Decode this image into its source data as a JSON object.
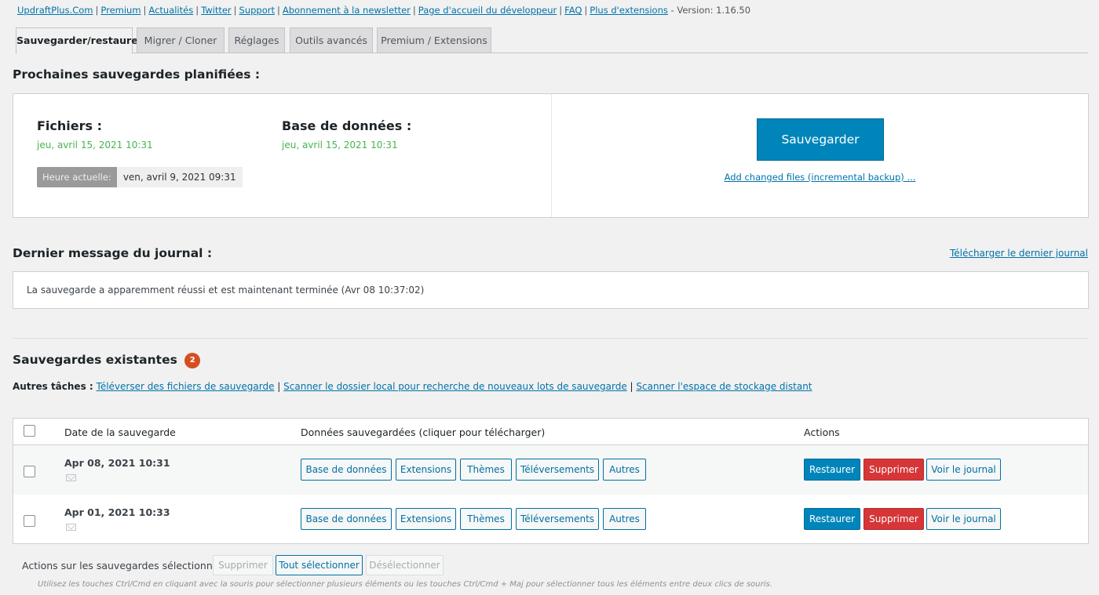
{
  "toplinks": [
    "UpdraftPlus.Com",
    "Premium",
    "Actualités",
    "Twitter",
    "Support",
    "Abonnement à la newsletter",
    "Page d'accueil du développeur",
    "FAQ",
    "Plus d'extensions"
  ],
  "version": "- Version: 1.16.50",
  "tabs": [
    "Sauvegarder/restaurer",
    "Migrer / Cloner",
    "Réglages",
    "Outils avancés",
    "Premium / Extensions"
  ],
  "scheduled": {
    "heading": "Prochaines sauvegardes planifiées :",
    "files_label": "Fichiers :",
    "files_date": "jeu, avril 15, 2021 10:31",
    "db_label": "Base de données :",
    "db_date": "jeu, avril 15, 2021 10:31",
    "current_time_label": "Heure actuelle:",
    "current_time_value": "ven, avril 9, 2021 09:31",
    "backup_button": "Sauvegarder",
    "incremental_link": "Add changed files (incremental backup) ..."
  },
  "log": {
    "heading": "Dernier message du journal :",
    "download_link": "Télécharger le dernier journal",
    "message": "La sauvegarde a apparemment réussi et est maintenant terminée (Avr 08 10:37:02)"
  },
  "existing": {
    "heading": "Sauvegardes existantes",
    "count": "2",
    "other_tasks_label": "Autres tâches :",
    "other_links": [
      "Téléverser des fichiers de sauvegarde",
      "Scanner le dossier local pour recherche de nouveaux lots de sauvegarde",
      "Scanner l'espace de stockage distant"
    ]
  },
  "table": {
    "headers": [
      "Date de la sauvegarde",
      "Données sauvegardées (cliquer pour télécharger)",
      "Actions"
    ],
    "data_buttons": [
      "Base de données",
      "Extensions",
      "Thèmes",
      "Téléversements",
      "Autres"
    ],
    "action_buttons": [
      "Restaurer",
      "Supprimer",
      "Voir le journal"
    ],
    "rows": [
      {
        "date": "Apr 08, 2021 10:31"
      },
      {
        "date": "Apr 01, 2021 10:33"
      }
    ]
  },
  "bottom": {
    "label": "Actions sur les sauvegardes sélectionnées",
    "delete": "Supprimer",
    "select_all": "Tout sélectionner",
    "deselect": "Désélectionner",
    "hint": "Utilisez les touches Ctrl/Cmd en cliquant avec la souris pour sélectionner plusieurs éléments ou les touches Ctrl/Cmd + Maj pour sélectionner tous les éléments entre deux clics de souris."
  },
  "colors": {
    "primary": "#0085ba",
    "danger": "#d63638",
    "success": "#46b450",
    "badge": "#d54e21"
  }
}
